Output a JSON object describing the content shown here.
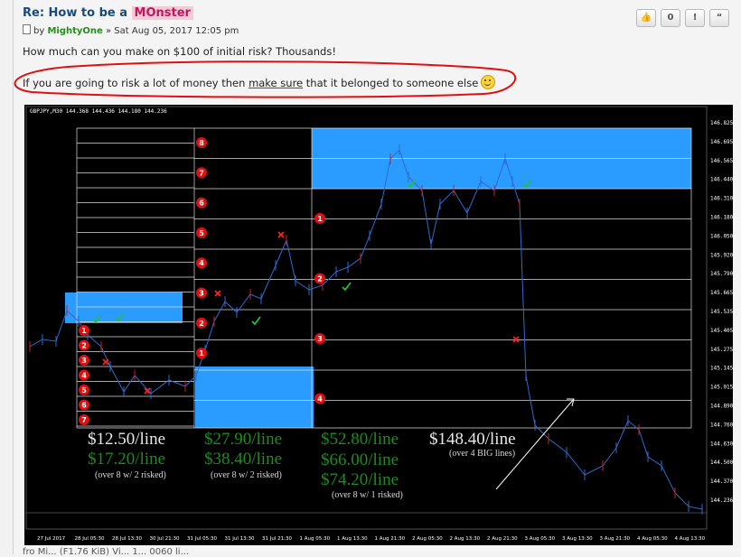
{
  "post": {
    "title_prefix": "Re: How to be a ",
    "title_highlight": "MOnster",
    "by": "by",
    "author": "MightyOne",
    "date": " » Sat Aug 05, 2017 12:05 pm",
    "buttons": [
      "👍",
      "0",
      "!",
      "“"
    ],
    "p1": "How much can you make on $100 of initial risk? Thousands!",
    "p2_a": "If you are going to risk a lot of money then ",
    "p2_b": "make sure",
    "p2_c": " that it belonged to someone else",
    "footer": "fro Mi... (F1.76 KiB) Vi... 1... 0060 li..."
  },
  "chart": {
    "header": "GBPJPY,M30  144.368 144.436 144.180 144.236",
    "price_labels": [
      "146.825",
      "146.695",
      "146.565",
      "146.440",
      "146.310",
      "146.180",
      "146.050",
      "145.920",
      "145.790",
      "145.665",
      "145.535",
      "145.405",
      "145.275",
      "145.145",
      "145.015",
      "144.890",
      "144.760",
      "144.630",
      "144.500",
      "144.370",
      "144.236"
    ],
    "date_labels": [
      "27 Jul 2017",
      "28 Jul 05:30",
      "28 Jul 13:30",
      "30 Jul 21:30",
      "31 Jul 05:30",
      "31 Jul 13:30",
      "31 Jul 21:30",
      "1 Aug 05:30",
      "1 Aug 13:30",
      "1 Aug 21:30",
      "2 Aug 05:30",
      "2 Aug 13:30",
      "2 Aug 21:30",
      "3 Aug 05:30",
      "3 Aug 13:30",
      "3 Aug 21:30",
      "4 Aug 05:30",
      "4 Aug 13:30"
    ],
    "profit": [
      {
        "main": "$12.50/line",
        "second": "$17.20/line",
        "note": "(over 8 w/ 2 risked)"
      },
      {
        "main": "$27.90/line",
        "second": "$38.40/line",
        "note": "(over 8 w/ 2 risked)"
      },
      {
        "main": "$52.80/line",
        "second": "$66.00/line",
        "third": "$74.20/line",
        "note": "(over 8 w/ 1 risked)"
      },
      {
        "main": "$148.40/line",
        "note": "(over 4 BIG lines)"
      }
    ],
    "markers_col1": [
      "1",
      "2",
      "3",
      "4",
      "5",
      "6",
      "7"
    ],
    "markers_col2": [
      "8",
      "7",
      "6",
      "5",
      "4",
      "3",
      "2",
      "1"
    ],
    "markers_col3": [
      "1",
      "2",
      "3",
      "4"
    ]
  }
}
